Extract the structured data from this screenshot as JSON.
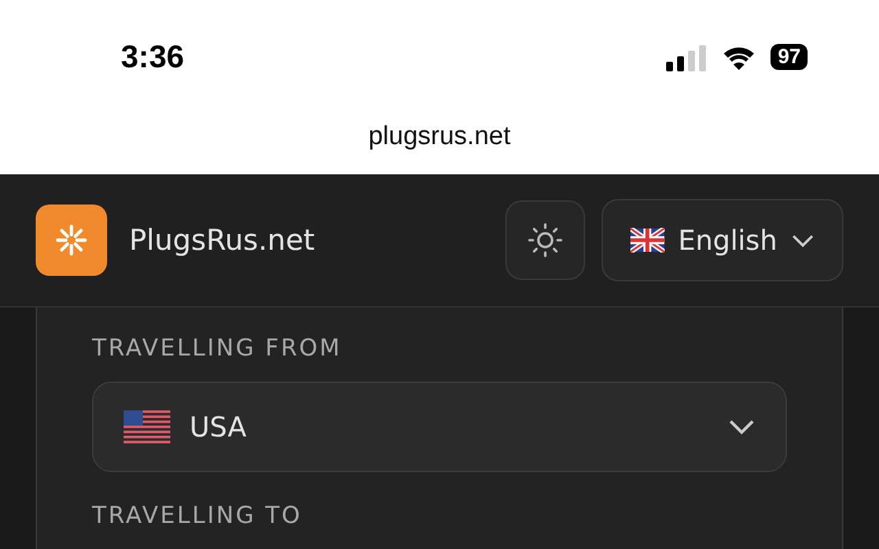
{
  "status_bar": {
    "time": "3:36",
    "battery": "97"
  },
  "address_bar": {
    "url": "plugsrus.net"
  },
  "header": {
    "site_name": "PlugsRus.net",
    "language": "English"
  },
  "form": {
    "fields": [
      {
        "label": "TRAVELLING FROM",
        "value": "USA"
      },
      {
        "label": "TRAVELLING TO"
      }
    ]
  }
}
